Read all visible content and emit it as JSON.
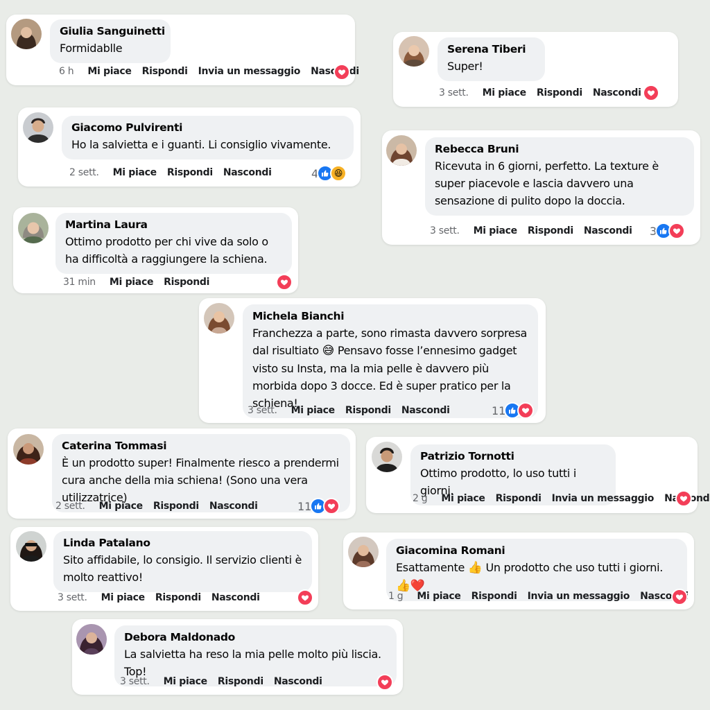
{
  "colors": {
    "background": "#e9ece8",
    "bubble": "#eff1f3",
    "like": "#1877f2",
    "love": "#f33e58",
    "haha": "#f7b125"
  },
  "comments": [
    {
      "name": "Giulia Sanguinetti",
      "text": "Formidablle",
      "time": "6 h",
      "actions": [
        "Mi piace",
        "Rispondi",
        "Invia un messaggio",
        "Nascondi"
      ],
      "reactions": {
        "count": "",
        "icons": [
          "love-icon"
        ]
      }
    },
    {
      "name": "Serena Tiberi",
      "text": "Super!",
      "time": "3 sett.",
      "actions": [
        "Mi piace",
        "Rispondi",
        "Nascondi"
      ],
      "reactions": {
        "count": "",
        "icons": [
          "love-icon"
        ]
      }
    },
    {
      "name": "Giacomo Pulvirenti",
      "text": "Ho la salvietta e i guanti. Li consiglio vivamente.",
      "time": "2 sett.",
      "actions": [
        "Mi piace",
        "Rispondi",
        "Nascondi"
      ],
      "reactions": {
        "count": "4",
        "icons": [
          "like-icon",
          "haha-icon"
        ]
      }
    },
    {
      "name": "Rebecca Bruni",
      "text": "Ricevuta in 6 giorni, perfetto. La texture è super piacevole e lascia davvero una sensazione di pulito dopo la doccia.",
      "time": "3 sett.",
      "actions": [
        "Mi piace",
        "Rispondi",
        "Nascondi"
      ],
      "reactions": {
        "count": "3",
        "icons": [
          "like-icon",
          "love-icon"
        ]
      }
    },
    {
      "name": "Martina Laura",
      "text": "Ottimo prodotto per chi vive da solo o ha difficoltà a raggiungere la schiena.",
      "time": "31 min",
      "actions": [
        "Mi piace",
        "Rispondi"
      ],
      "reactions": {
        "count": "",
        "icons": [
          "love-icon"
        ]
      }
    },
    {
      "name": "Michela Bianchi",
      "text_parts": [
        "Franchezza a parte, sono rimasta davvero sorpresa dal risultiato ",
        "😅",
        " Pensavo fosse l’ennesimo gadget visto su Insta, ma la mia pelle è davvero più morbida dopo 3 docce. Ed è super pratico per la schiena!"
      ],
      "time": "3 sett.",
      "actions": [
        "Mi piace",
        "Rispondi",
        "Nascondi"
      ],
      "reactions": {
        "count": "11",
        "icons": [
          "like-icon",
          "love-icon"
        ]
      }
    },
    {
      "name": "Caterina Tommasi",
      "text": "È un prodotto super! Finalmente riesco a prendermi cura anche della mia schiena! (Sono una vera utilizzatrice)",
      "time": "2 sett.",
      "actions": [
        "Mi piace",
        "Rispondi",
        "Nascondi"
      ],
      "reactions": {
        "count": "11",
        "icons": [
          "like-icon",
          "love-icon"
        ]
      }
    },
    {
      "name": "Patrizio Tornotti",
      "text": "Ottimo prodotto, lo uso tutti i giorni.",
      "time": "2 g",
      "actions": [
        "Mi piace",
        "Rispondi",
        "Invia un messaggio",
        "Nascondi"
      ],
      "reactions": {
        "count": "",
        "icons": [
          "love-icon"
        ]
      }
    },
    {
      "name": "Linda Patalano",
      "text": "Sito affidabile, lo consigio. Il servizio clienti è molto reattivo!",
      "time": "3 sett.",
      "actions": [
        "Mi piace",
        "Rispondi",
        "Nascondi"
      ],
      "reactions": {
        "count": "",
        "icons": [
          "love-icon"
        ]
      }
    },
    {
      "name": "Giacomina Romani",
      "text_parts": [
        "Esattamente ",
        "👍",
        " Un prodotto che uso tutti i giorni. ",
        "👍❤️"
      ],
      "time": "1 g",
      "actions": [
        "Mi piace",
        "Rispondi",
        "Invia un messaggio",
        "Nascondi"
      ],
      "reactions": {
        "count": "",
        "icons": [
          "love-icon"
        ]
      }
    },
    {
      "name": "Debora Maldonado",
      "text": "La salvietta ha reso la mia pelle molto più liscia. Top!",
      "time": "3 sett.",
      "actions": [
        "Mi piace",
        "Rispondi",
        "Nascondi"
      ],
      "reactions": {
        "count": "",
        "icons": [
          "love-icon"
        ]
      }
    }
  ]
}
